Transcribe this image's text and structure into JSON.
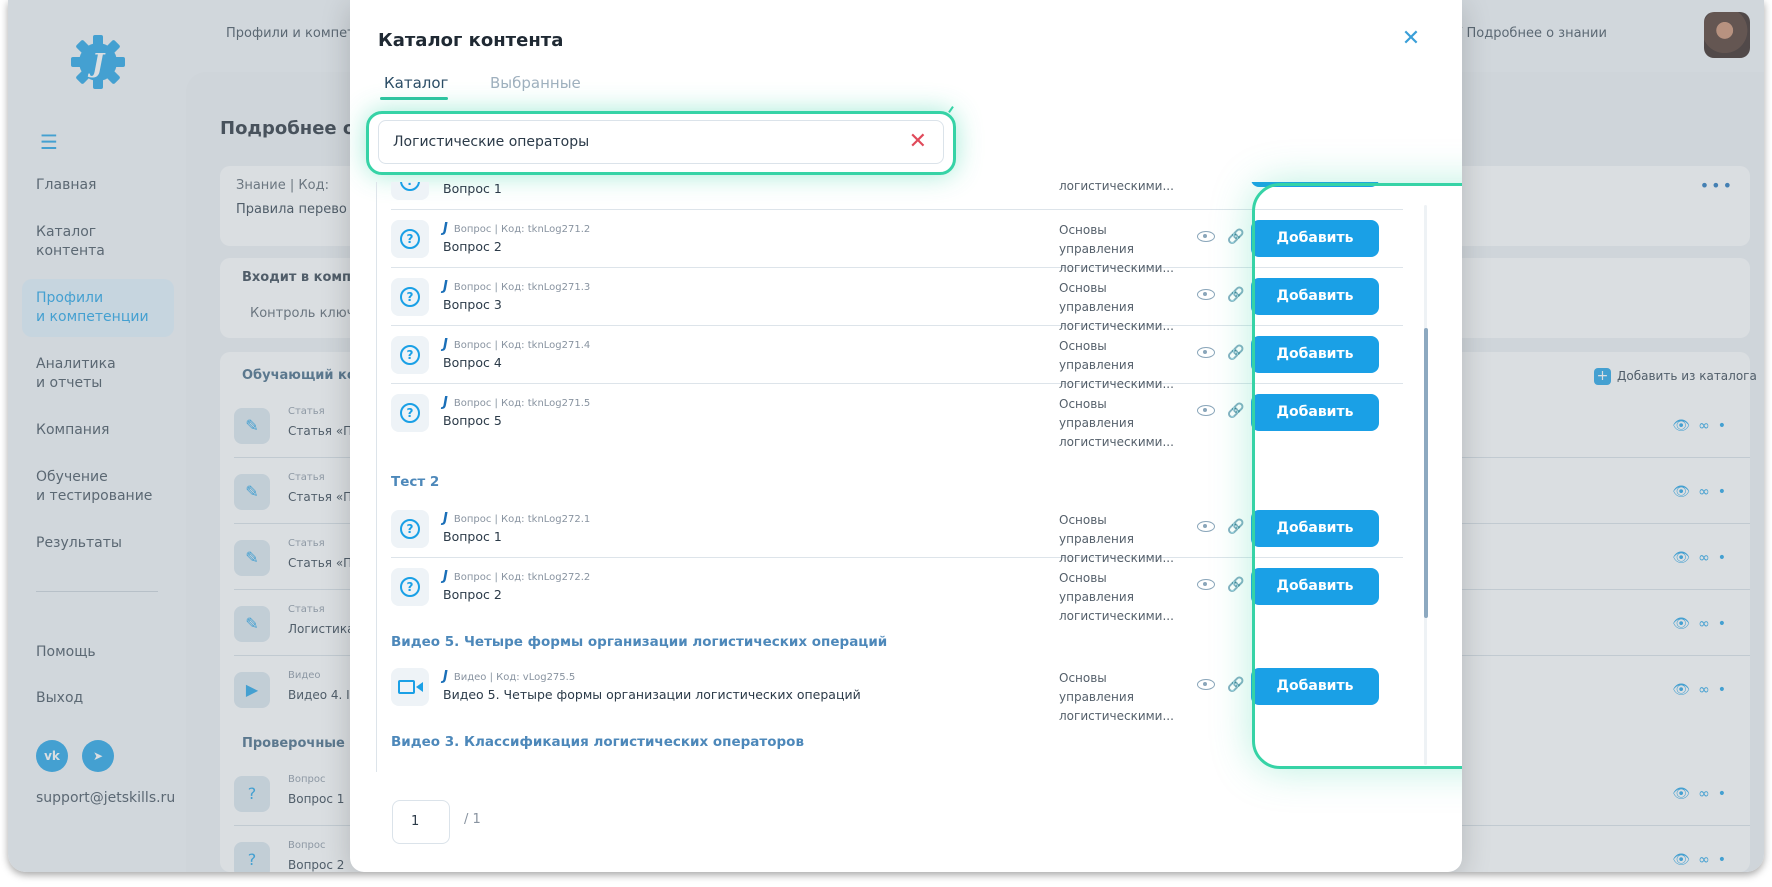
{
  "app": {
    "brand_letter": "J",
    "nav": [
      {
        "label": "Главная",
        "active": false
      },
      {
        "label": "Каталог контента",
        "active": false
      },
      {
        "label": "Профили\nи компетенции",
        "active": true
      },
      {
        "label": "Аналитика\nи отчеты",
        "active": false
      },
      {
        "label": "Компания",
        "active": false
      },
      {
        "label": "Обучение\nи тестирование",
        "active": false
      },
      {
        "label": "Результаты",
        "active": false
      }
    ],
    "help": "Помощь",
    "logout": "Выход",
    "vk": "vk",
    "support_email": "support@jetskills.ru"
  },
  "background": {
    "breadcrumb_left": "Профили и компет",
    "breadcrumb_right": "/ Подробнее о знании",
    "page_title": "Подробнее о",
    "knowledge_meta": "Знание | Код:",
    "knowledge_text": "Правила перево",
    "includes_head": "Входит в компе",
    "includes_item": "Контроль ключ",
    "training_head": "Обучающий кон",
    "add_from_catalog": "Добавить из каталога",
    "rows": [
      {
        "meta": "Статья",
        "text": "Статья «П"
      },
      {
        "meta": "Статья",
        "text": "Статья «П"
      },
      {
        "meta": "Статья",
        "text": "Статья «П"
      },
      {
        "meta": "Статья",
        "text": "Логистика"
      },
      {
        "meta": "Видео",
        "text": "Видео 4. I"
      }
    ],
    "checks_head": "Проверочные з",
    "check_rows": [
      {
        "meta": "Вопрос",
        "text": "Вопрос 1"
      },
      {
        "meta": "Вопрос",
        "text": "Вопрос 2"
      }
    ]
  },
  "modal": {
    "title": "Каталог контента",
    "tabs": [
      {
        "label": "Каталог",
        "active": true
      },
      {
        "label": "Выбранные",
        "active": false
      }
    ],
    "search": {
      "value": "Логистические операторы",
      "placeholder": ""
    },
    "items": [
      {
        "type": "question",
        "meta": "",
        "title": "Вопрос 1",
        "course": "логистическими..."
      },
      {
        "type": "question",
        "meta": "Вопрос  |  Код: tknLog271.2",
        "title": "Вопрос 2",
        "course": "Основы управления логистическими..."
      },
      {
        "type": "question",
        "meta": "Вопрос  |  Код: tknLog271.3",
        "title": "Вопрос 3",
        "course": "Основы управления логистическими..."
      },
      {
        "type": "question",
        "meta": "Вопрос  |  Код: tknLog271.4",
        "title": "Вопрос 4",
        "course": "Основы управления логистическими..."
      },
      {
        "type": "question",
        "meta": "Вопрос  |  Код: tknLog271.5",
        "title": "Вопрос 5",
        "course": "Основы управления логистическими..."
      },
      {
        "type": "question",
        "meta": "Вопрос  |  Код: tknLog272.1",
        "title": "Вопрос 1",
        "course": "Основы управления логистическими..."
      },
      {
        "type": "question",
        "meta": "Вопрос  |  Код: tknLog272.2",
        "title": "Вопрос 2",
        "course": "Основы управления логистическими..."
      },
      {
        "type": "video",
        "meta": "Видео  |  Код: vLog275.5",
        "title": "Видео 5. Четыре формы организации логистических операций",
        "course": "Основы управления логистическими..."
      }
    ],
    "groups": {
      "test2": "Тест 2",
      "video5": "Видео 5. Четыре формы организации логистических операций",
      "video3": "Видео 3. Классификация логистических операторов"
    },
    "add_label": "Добавить",
    "page": "1",
    "page_total": "/ 1"
  },
  "colors": {
    "accent": "#1aa0e6",
    "highlight": "#36d3a6",
    "danger": "#e04a5a"
  }
}
